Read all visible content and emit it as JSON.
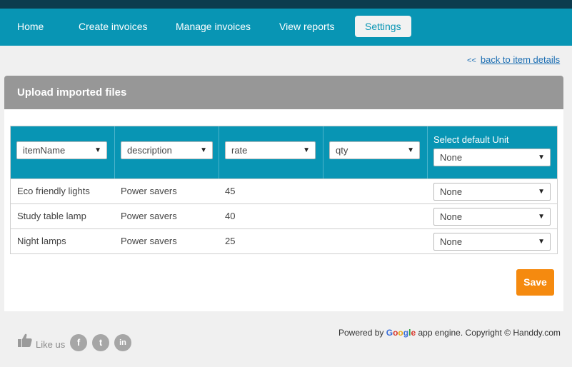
{
  "nav": {
    "items": [
      {
        "label": "Home"
      },
      {
        "label": "Create invoices"
      },
      {
        "label": "Manage invoices"
      },
      {
        "label": "View reports"
      },
      {
        "label": "Settings",
        "active": true
      }
    ]
  },
  "backlink": {
    "arrows": "<<",
    "label": "back to item details"
  },
  "panel": {
    "title": "Upload imported files"
  },
  "table": {
    "header_selects": [
      "itemName",
      "description",
      "rate",
      "qty"
    ],
    "unit_label": "Select default Unit",
    "unit_default": "None",
    "rows": [
      {
        "name": "Eco friendly lights",
        "description": "Power savers",
        "rate": "45",
        "qty": "",
        "unit": "None"
      },
      {
        "name": "Study table lamp",
        "description": "Power savers",
        "rate": "40",
        "qty": "",
        "unit": "None"
      },
      {
        "name": "Night lamps",
        "description": "Power savers",
        "rate": "25",
        "qty": "",
        "unit": "None"
      }
    ]
  },
  "save_label": "Save",
  "footer": {
    "like_text": "Like us",
    "social": {
      "facebook": "f",
      "twitter": "t",
      "linkedin": "in"
    },
    "powered_prefix": "Powered by",
    "google_letters": [
      "G",
      "o",
      "o",
      "g",
      "l",
      "e"
    ],
    "powered_suffix": "app engine. Copyright © Handdy.com"
  },
  "colors": {
    "nav_bg": "#0895b4",
    "top_strip": "#0c3c4e",
    "panel_head": "#979797",
    "save_button": "#f58a0f",
    "link": "#1d6fb3"
  }
}
